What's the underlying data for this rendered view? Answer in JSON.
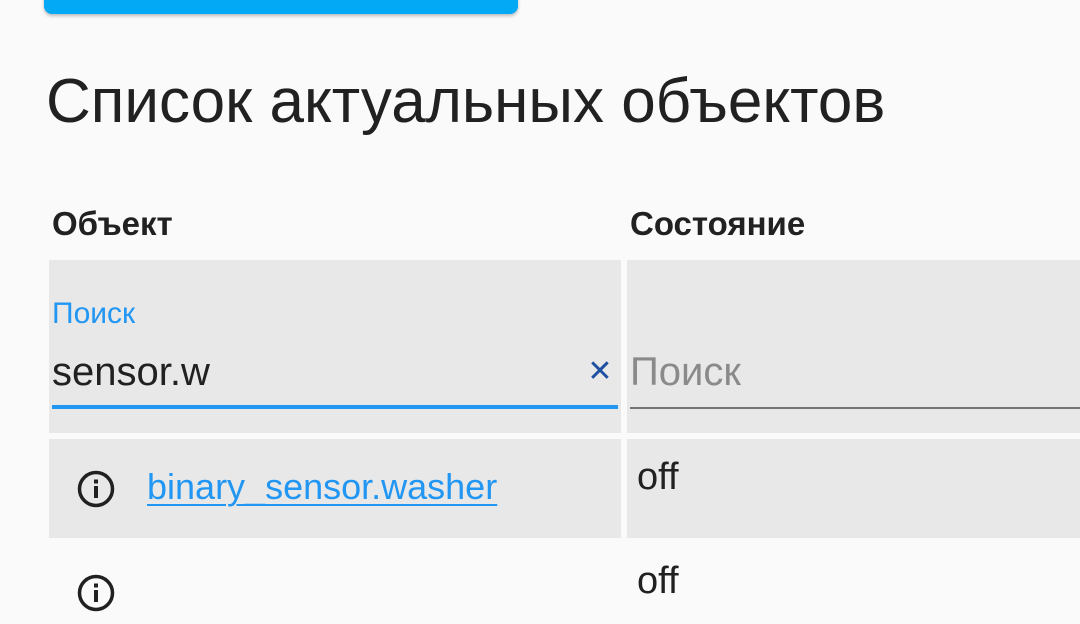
{
  "title": "Список актуальных объектов",
  "table": {
    "headers": {
      "entity": "Объект",
      "state": "Состояние"
    },
    "filters": {
      "entity": {
        "label": "Поиск",
        "value": "sensor.w",
        "clear_icon": "close-icon"
      },
      "state": {
        "placeholder": "Поиск"
      }
    },
    "rows": [
      {
        "entity_id": "binary_sensor.washer",
        "state": "off",
        "icon": "info-circle-icon"
      },
      {
        "entity_id": "",
        "state": "off",
        "icon": "info-circle-icon"
      }
    ]
  },
  "colors": {
    "accent": "#03a9f4",
    "link": "#2196f3",
    "cell_background": "#e8e8e8",
    "page_background": "#fafafa"
  }
}
